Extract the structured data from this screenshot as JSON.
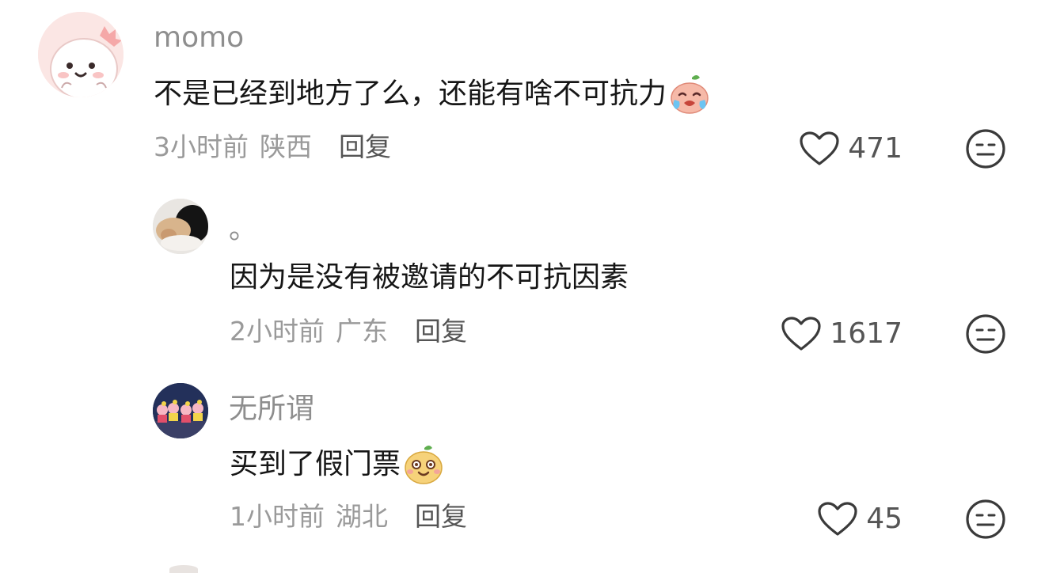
{
  "comments": [
    {
      "username": "momo",
      "text": "不是已经到地方了么，还能有啥不可抗力",
      "emoji": "crying-face-emoji",
      "time": "3小时前",
      "location": "陕西",
      "reply_label": "回复",
      "likes": "471",
      "avatar": "pink-dinosaur-avatar"
    },
    {
      "username": "。",
      "text": "因为是没有被邀请的不可抗因素",
      "emoji": "",
      "time": "2小时前",
      "location": "广东",
      "reply_label": "回复",
      "likes": "1617",
      "avatar": "sleeping-cats-avatar"
    },
    {
      "username": "无所谓",
      "text": "买到了假门票",
      "emoji": "surprised-face-emoji",
      "time": "1小时前",
      "location": "湖北",
      "reply_label": "回复",
      "likes": "45",
      "avatar": "cartoon-characters-avatar"
    }
  ],
  "icons": {
    "like": "heart-outline-icon",
    "dislike": "meh-face-icon"
  },
  "colors": {
    "text_primary": "#161616",
    "text_secondary": "#9a9a9a",
    "username": "#8e8e8e",
    "icon_stroke": "#3a3a3a"
  }
}
